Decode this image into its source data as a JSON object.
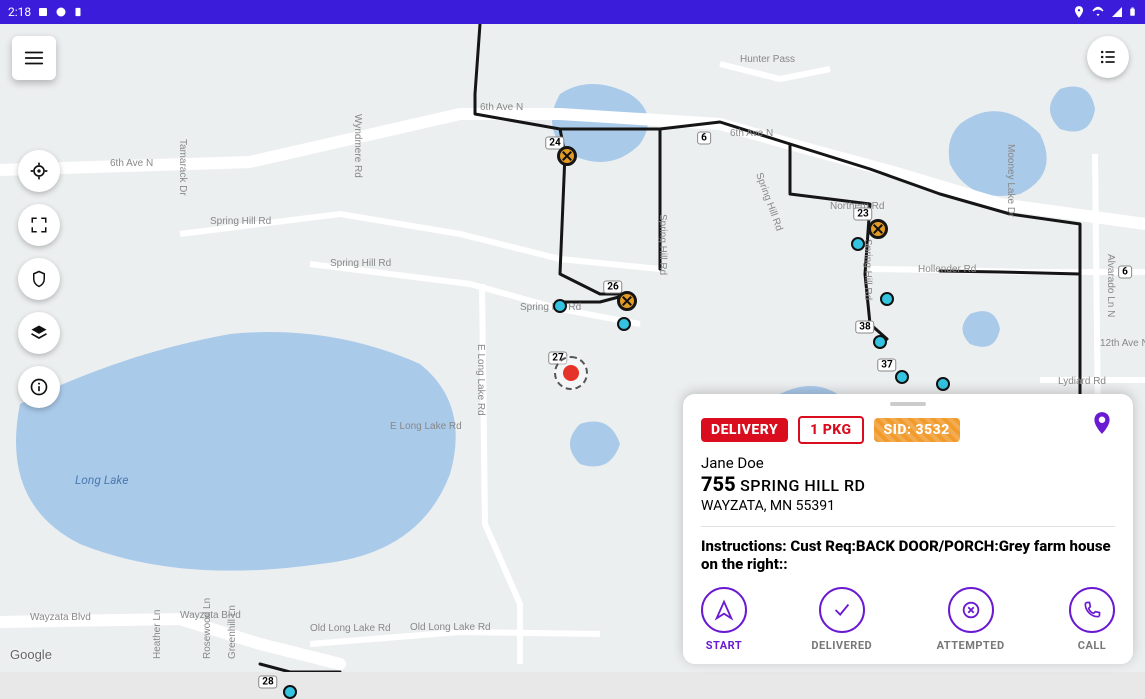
{
  "status_bar": {
    "time": "2:18"
  },
  "map": {
    "attribution": "Google",
    "lake_label": "Long Lake",
    "road_labels": {
      "sixth_ave_n_a": "6th Ave N",
      "sixth_ave_n_b": "6th Ave N",
      "sixth_ave_n_c": "6th Ave N",
      "spring_hill_a": "Spring Hill Rd",
      "spring_hill_b": "Spring Hill Rd",
      "spring_hill_c": "Spring Hill Rd",
      "spring_hill_d": "Spring Hill Rd",
      "spring_hill_e": "Spring Hill Rd",
      "spring_hill_f": "Spring Hill Rd",
      "tamarack": "Tamarack Dr",
      "wyndmere": "Wyndmere Rd",
      "e_long_lake_a": "E Long Lake Rd",
      "e_long_lake_b": "E Long Lake Rd",
      "old_long_lake": "Old Long Lake Rd",
      "old_long_lake_b": "Old Long Lake Rd",
      "wayzata_blvd": "Wayzata Blvd",
      "wayzata_blvd_b": "Wayzata Blvd",
      "hollender": "Hollender Rd",
      "mooney_lake": "Mooney Lake Dr",
      "hunter_pass": "Hunter Pass",
      "twelfth_ave": "12th Ave N",
      "lydiard": "Lydiard Rd",
      "northern": "Northern Rd",
      "greenhill": "Greenhill Ln",
      "rosewood": "Rosewood Ln",
      "heather": "Heather Ln",
      "alvarado": "Alvarado Ln N"
    },
    "stop_numbers": {
      "s24": "24",
      "s23": "23",
      "s26": "26",
      "s27": "27",
      "s28": "28",
      "s38": "38",
      "s37": "37",
      "s6a": "6",
      "s6b": "6"
    }
  },
  "card": {
    "delivery_badge": "DELIVERY",
    "pkg_badge": "1 PKG",
    "sid_badge": "SID: 3532",
    "customer_name": "Jane Doe",
    "street_number": "755",
    "street_name": " SPRING HILL RD",
    "city_line": "WAYZATA, MN 55391",
    "instructions_label": "Instructions: ",
    "instructions_text": "Cust Req:BACK DOOR/PORCH:Grey farm house on the right::",
    "actions": {
      "start": "START",
      "delivered": "DELIVERED",
      "attempted": "ATTEMPTED",
      "call": "CALL"
    }
  }
}
